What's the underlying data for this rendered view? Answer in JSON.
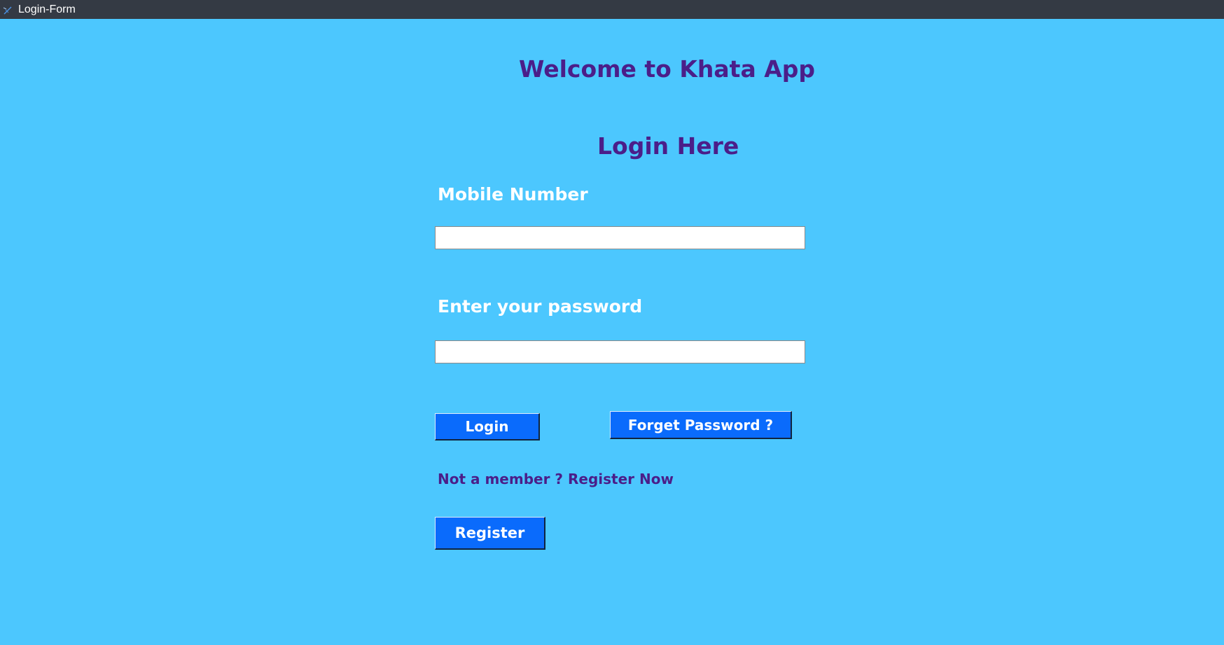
{
  "window": {
    "title": "Login-Form",
    "icon": "feather-icon"
  },
  "colors": {
    "background": "#4cc7fe",
    "titlebar": "#343a44",
    "heading": "#4b1e89",
    "button": "#0a6bfc",
    "label": "#ffffff"
  },
  "form": {
    "welcome": "Welcome to Khata App",
    "heading": "Login Here",
    "mobile_label": "Mobile Number",
    "mobile_value": "",
    "password_label": "Enter your password",
    "password_value": "",
    "login_label": "Login",
    "forget_label": "Forget Password ?",
    "member_text": "Not a member ? Register Now",
    "register_label": "Register"
  }
}
